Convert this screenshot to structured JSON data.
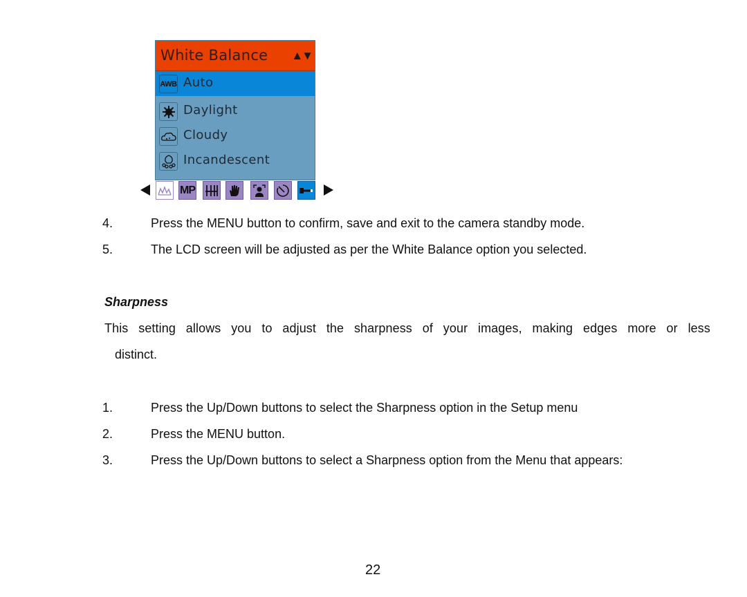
{
  "menu": {
    "title": "White Balance",
    "scroll_indicator": "▲▼",
    "items": [
      {
        "icon": "awb-icon",
        "icon_text": "AWB",
        "label": "Auto",
        "selected": true
      },
      {
        "icon": "sun-icon",
        "label": "Daylight",
        "selected": false
      },
      {
        "icon": "cloud-icon",
        "label": "Cloudy",
        "selected": false
      },
      {
        "icon": "bulb-icon",
        "label": "Incandescent",
        "selected": false
      }
    ],
    "colors": {
      "header": "#ea4000",
      "selected": "#0a86d8",
      "body": "#6a9ec0",
      "toolbar_icon": "#9b86c4"
    }
  },
  "toolbar": {
    "icons": [
      {
        "name": "scene-icon"
      },
      {
        "name": "resolution-icon",
        "text": "MP"
      },
      {
        "name": "quality-icon"
      },
      {
        "name": "stabilizer-icon"
      },
      {
        "name": "face-detect-icon"
      },
      {
        "name": "self-timer-icon"
      },
      {
        "name": "setup-wrench-icon",
        "active": true
      }
    ]
  },
  "steps_top": [
    {
      "num": "4.",
      "text": "Press the MENU button to confirm, save and exit to the camera standby mode."
    },
    {
      "num": "5.",
      "text": "The LCD screen will be adjusted as per the White Balance option you selected."
    }
  ],
  "section": {
    "heading": "Sharpness",
    "paragraph_line1": "This setting allows you to adjust the sharpness of your images, making edges more or less",
    "paragraph_line2": "distinct."
  },
  "steps_bottom": [
    {
      "num": "1.",
      "text": "Press the Up/Down buttons to select the Sharpness option in the Setup menu"
    },
    {
      "num": "2.",
      "text": "Press the MENU button."
    },
    {
      "num": "3.",
      "text": "Press the Up/Down buttons to select a Sharpness option from the Menu that appears:"
    }
  ],
  "page_number": "22"
}
